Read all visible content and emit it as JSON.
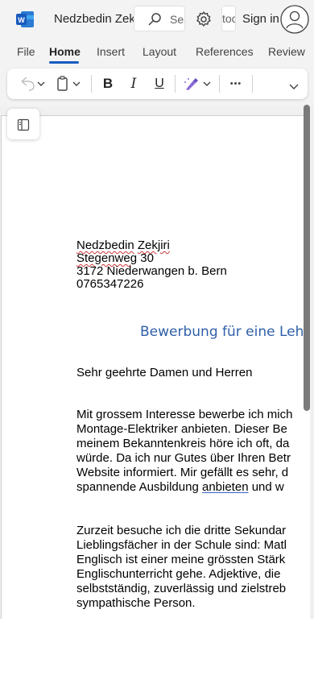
{
  "titlebar": {
    "doc_title": "Nedzbedin Zekjiri b",
    "search_text": "Sea",
    "mini_text": "toc",
    "signin_label": "Sign in"
  },
  "tabs": [
    "File",
    "Home",
    "Insert",
    "Layout",
    "References",
    "Review"
  ],
  "active_tab": "Home",
  "accent_color": "#185abd",
  "ribbon": {
    "undo_icon": "undo-icon",
    "paste_icon": "clipboard-icon",
    "bold_label": "B",
    "italic_label": "I",
    "underline_label": "U",
    "highlight_icon": "highlighter-icon",
    "more_label": "•••"
  },
  "document": {
    "address": {
      "name_first": "Nedzbedin",
      "name_last": "Zekjiri",
      "street_word": "Stegenweg",
      "street_num": "30",
      "city": "3172 Niederwangen b. Bern",
      "phone": "0765347226"
    },
    "heading": "Bewerbung für eine Leh",
    "salutation": "Sehr geehrte Damen und Herren",
    "para1": [
      "Mit grossem Interesse bewerbe ich mich",
      "Montage-Elektriker anbieten. Dieser Be",
      "meinem Bekanntenkreis höre ich oft, da",
      "würde. Da ich nur Gutes über Ihren Betr",
      "Website informiert. Mir gefällt es sehr, d",
      "spannende Ausbildung"
    ],
    "para1_underlined": "anbieten",
    "para1_tail": "und w",
    "para2": [
      "Zurzeit besuche ich die dritte Sekundar",
      "Lieblingsfächer in der Schule sind: Matl",
      "Englisch ist einer meine grössten Stärk",
      "Englischunterricht gehe. Adjektive, die",
      "selbstständig, zuverlässig und zielstreb",
      "sympathische Person."
    ]
  }
}
